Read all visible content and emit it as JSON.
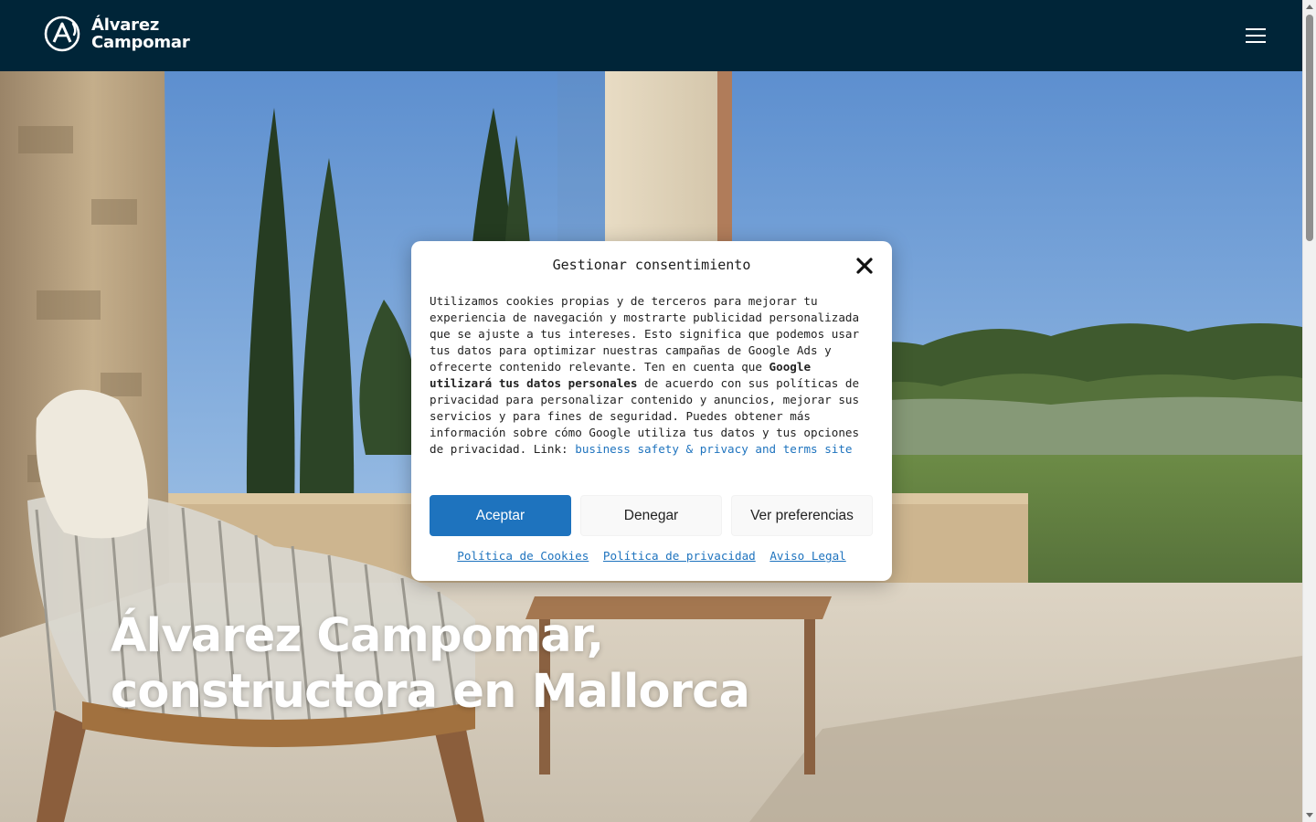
{
  "header": {
    "logo_line1": "Álvarez",
    "logo_line2": "Campomar",
    "menu_icon": "hamburger-menu-icon",
    "background_color": "#002538"
  },
  "hero": {
    "title_line1": "Álvarez Campomar,",
    "title_line2": "constructora en Mallorca"
  },
  "consent": {
    "title": "Gestionar consentimiento",
    "close_icon": "close-icon",
    "text_part1": "Utilizamos cookies propias y de terceros para mejorar tu experiencia de navegación y mostrarte publicidad personalizada que se ajuste a tus intereses. Esto significa que podemos usar tus datos para optimizar nuestras campañas de Google Ads y ofrecerte contenido relevante. Ten en cuenta que ",
    "text_bold": "Google utilizará tus datos personales",
    "text_part2": " de acuerdo con sus políticas de privacidad para personalizar contenido y anuncios, mejorar sus servicios y para fines de seguridad. Puedes obtener más información sobre cómo Google utiliza tus datos y tus opciones de privacidad. Link: ",
    "link_text": "business safety & privacy and terms site",
    "accept_label": "Aceptar",
    "deny_label": "Denegar",
    "preferences_label": "Ver preferencias",
    "footer_links": [
      "Política de Cookies",
      "Política de privacidad",
      "Aviso Legal"
    ],
    "accent_color": "#1e73be"
  }
}
